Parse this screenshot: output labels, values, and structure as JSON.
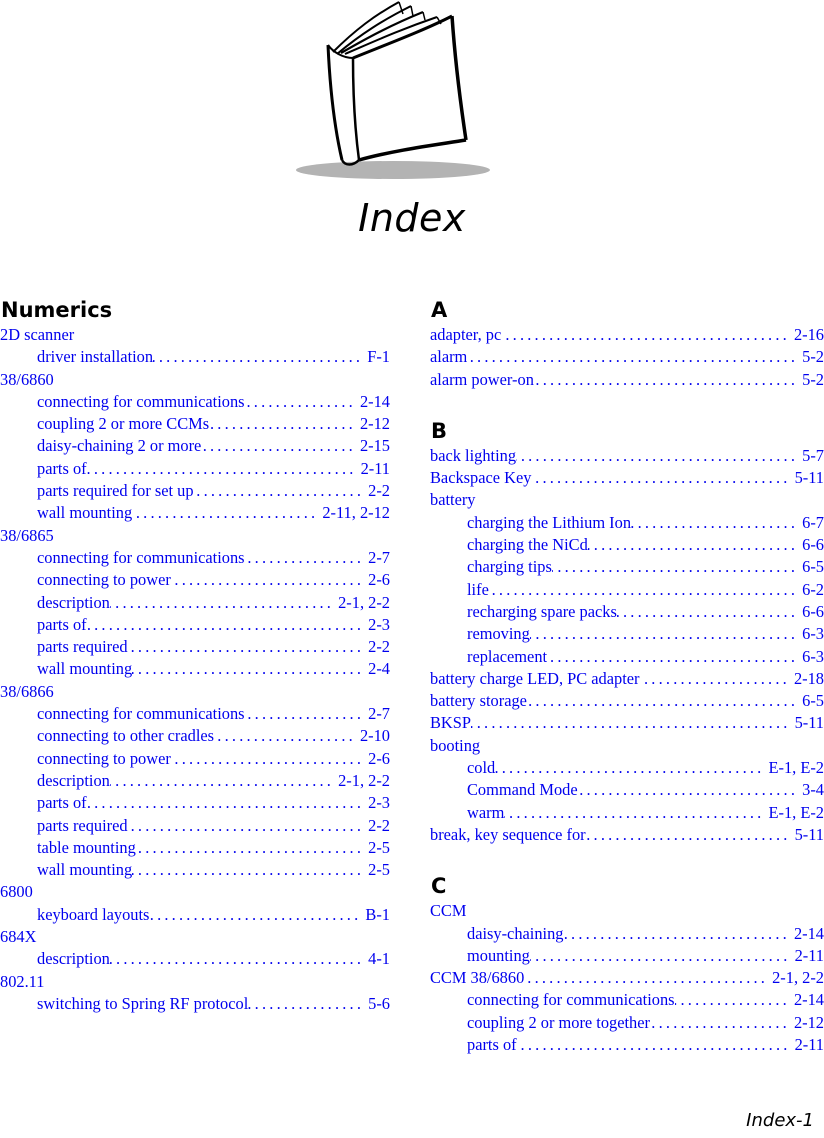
{
  "page": {
    "title": "Index",
    "footer": "Index-1",
    "link_color": "#0000ee"
  },
  "columns": [
    {
      "sections": [
        {
          "heading": "Numerics",
          "entries": [
            {
              "level": 0,
              "text": "2D scanner",
              "pages": ""
            },
            {
              "level": 1,
              "text": "driver installation",
              "pages": "F-1"
            },
            {
              "level": 0,
              "text": "38/6860",
              "pages": ""
            },
            {
              "level": 1,
              "text": "connecting for communications",
              "pages": "2-14"
            },
            {
              "level": 1,
              "text": "coupling 2 or more CCMs",
              "pages": "2-12"
            },
            {
              "level": 1,
              "text": "daisy-chaining 2 or more",
              "pages": "2-15"
            },
            {
              "level": 1,
              "text": "parts of",
              "pages": "2-11"
            },
            {
              "level": 1,
              "text": "parts required for set up",
              "pages": "2-2"
            },
            {
              "level": 1,
              "text": "wall mounting",
              "pages": "2-11, 2-12"
            },
            {
              "level": 0,
              "text": "38/6865",
              "pages": ""
            },
            {
              "level": 1,
              "text": "connecting for communications",
              "pages": "2-7"
            },
            {
              "level": 1,
              "text": "connecting to power",
              "pages": "2-6"
            },
            {
              "level": 1,
              "text": "description",
              "pages": "2-1, 2-2"
            },
            {
              "level": 1,
              "text": "parts of",
              "pages": "2-3"
            },
            {
              "level": 1,
              "text": "parts required",
              "pages": "2-2"
            },
            {
              "level": 1,
              "text": "wall mounting",
              "pages": "2-4"
            },
            {
              "level": 0,
              "text": "38/6866",
              "pages": ""
            },
            {
              "level": 1,
              "text": "connecting for communications",
              "pages": "2-7"
            },
            {
              "level": 1,
              "text": "connecting to other cradles",
              "pages": "2-10"
            },
            {
              "level": 1,
              "text": "connecting to power",
              "pages": "2-6"
            },
            {
              "level": 1,
              "text": "description",
              "pages": "2-1, 2-2"
            },
            {
              "level": 1,
              "text": "parts of",
              "pages": "2-3"
            },
            {
              "level": 1,
              "text": "parts required",
              "pages": "2-2"
            },
            {
              "level": 1,
              "text": "table mounting",
              "pages": "2-5"
            },
            {
              "level": 1,
              "text": "wall mounting",
              "pages": "2-5"
            },
            {
              "level": 0,
              "text": "6800",
              "pages": ""
            },
            {
              "level": 1,
              "text": "keyboard layouts",
              "pages": "B-1"
            },
            {
              "level": 0,
              "text": "684X",
              "pages": ""
            },
            {
              "level": 1,
              "text": "description",
              "pages": "4-1"
            },
            {
              "level": 0,
              "text": "802.11",
              "pages": ""
            },
            {
              "level": 1,
              "text": "switching to Spring RF protocol",
              "pages": "5-6"
            }
          ]
        }
      ]
    },
    {
      "sections": [
        {
          "heading": "A",
          "entries": [
            {
              "level": 0,
              "text": "adapter, pc",
              "pages": "2-16"
            },
            {
              "level": 0,
              "text": "alarm",
              "pages": "5-2"
            },
            {
              "level": 0,
              "text": "alarm power-on",
              "pages": "5-2"
            }
          ]
        },
        {
          "heading": "B",
          "entries": [
            {
              "level": 0,
              "text": "back lighting",
              "pages": "5-7"
            },
            {
              "level": 0,
              "text": "Backspace Key",
              "pages": "5-11"
            },
            {
              "level": 0,
              "text": "battery",
              "pages": ""
            },
            {
              "level": 1,
              "text": "charging the Lithium Ion",
              "pages": "6-7"
            },
            {
              "level": 1,
              "text": "charging the NiCd",
              "pages": "6-6"
            },
            {
              "level": 1,
              "text": "charging tips",
              "pages": "6-5"
            },
            {
              "level": 1,
              "text": "life",
              "pages": "6-2"
            },
            {
              "level": 1,
              "text": "recharging spare packs",
              "pages": "6-6"
            },
            {
              "level": 1,
              "text": "removing",
              "pages": "6-3"
            },
            {
              "level": 1,
              "text": "replacement",
              "pages": "6-3"
            },
            {
              "level": 0,
              "text": "battery charge LED, PC adapter",
              "pages": "2-18"
            },
            {
              "level": 0,
              "text": "battery storage",
              "pages": "6-5"
            },
            {
              "level": 0,
              "text": "BKSP",
              "pages": "5-11"
            },
            {
              "level": 0,
              "text": "booting",
              "pages": ""
            },
            {
              "level": 1,
              "text": "cold",
              "pages": "E-1, E-2"
            },
            {
              "level": 1,
              "text": "Command Mode",
              "pages": "3-4"
            },
            {
              "level": 1,
              "text": "warm",
              "pages": "E-1, E-2"
            },
            {
              "level": 0,
              "text": "break, key sequence for",
              "pages": "5-11"
            }
          ]
        },
        {
          "heading": "C",
          "entries": [
            {
              "level": 0,
              "text": "CCM",
              "pages": ""
            },
            {
              "level": 1,
              "text": "daisy-chaining",
              "pages": "2-14"
            },
            {
              "level": 1,
              "text": "mounting",
              "pages": "2-11"
            },
            {
              "level": 0,
              "text": "CCM 38/6860",
              "pages": "2-1, 2-2"
            },
            {
              "level": 1,
              "text": "connecting for communications",
              "pages": "2-14"
            },
            {
              "level": 1,
              "text": "coupling 2 or more together",
              "pages": "2-12"
            },
            {
              "level": 1,
              "text": "parts of",
              "pages": "2-11"
            }
          ]
        }
      ]
    }
  ]
}
